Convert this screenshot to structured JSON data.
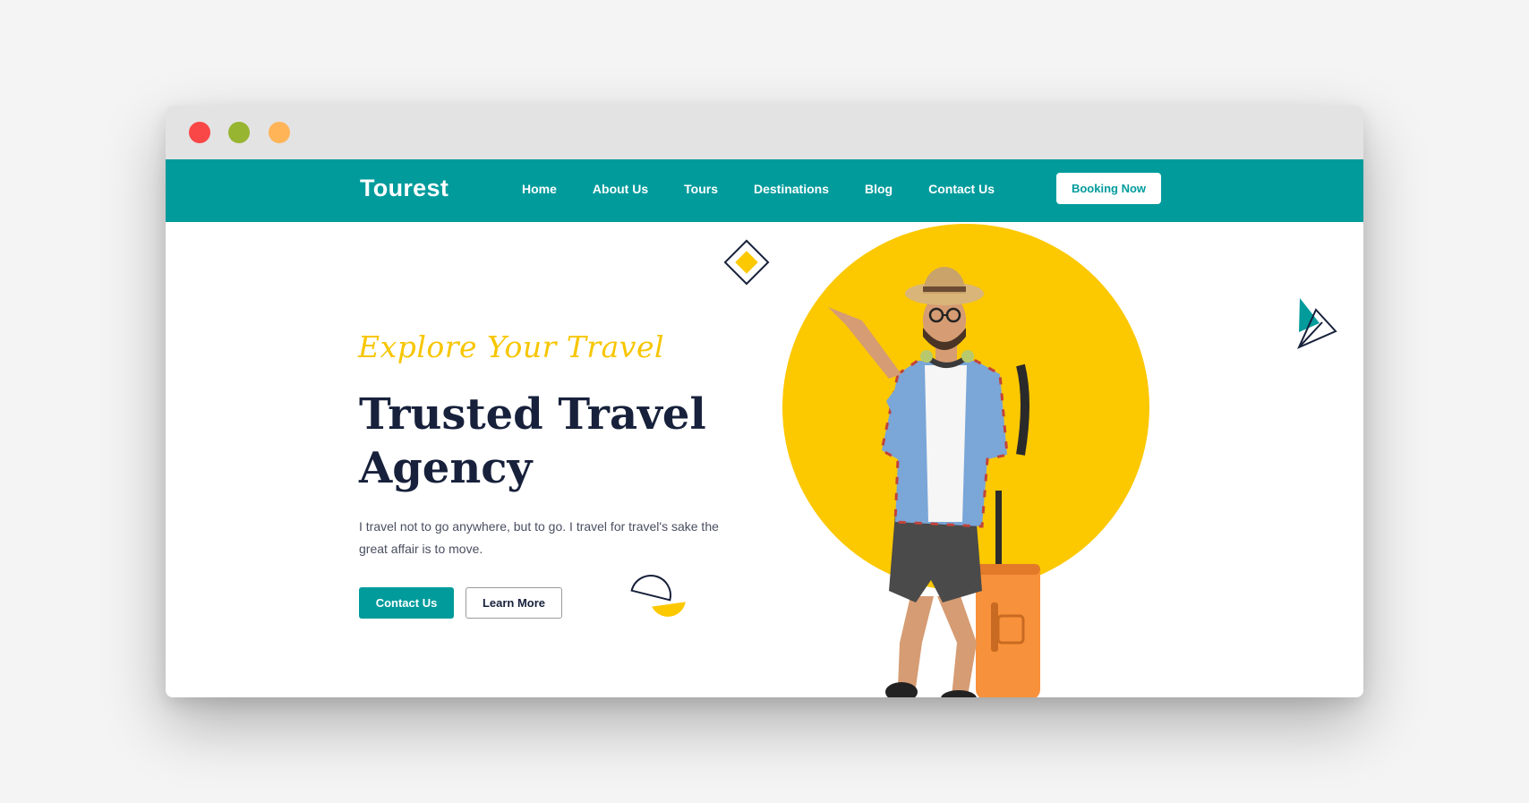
{
  "brand": "Tourest",
  "nav": {
    "items": [
      "Home",
      "About Us",
      "Tours",
      "Destinations",
      "Blog",
      "Contact Us"
    ],
    "booking_label": "Booking Now"
  },
  "hero": {
    "tagline": "Explore Your Travel",
    "title": "Trusted Travel Agency",
    "description": "I travel not to go anywhere, but to go. I travel for travel's sake the great affair is to move.",
    "primary_button": "Contact Us",
    "secondary_button": "Learn More"
  },
  "colors": {
    "accent": "#019b9c",
    "yellow": "#fcc800",
    "dark": "#17213b",
    "window_red": "#f94646",
    "window_green": "#97b530",
    "window_orange": "#ffb458"
  }
}
